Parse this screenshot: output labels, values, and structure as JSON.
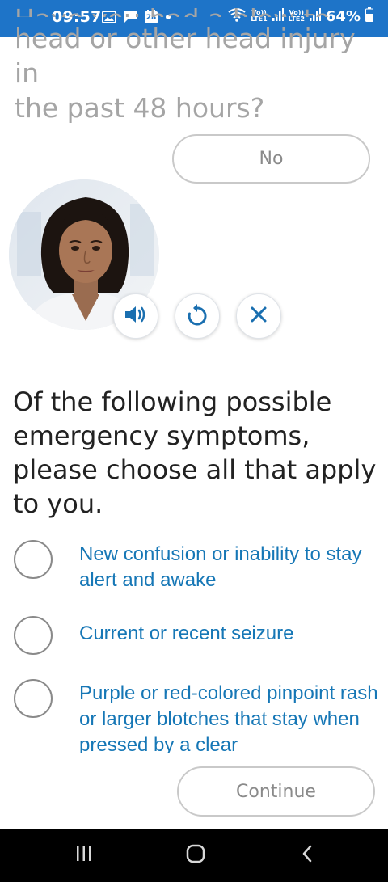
{
  "status_bar": {
    "time": "09:57",
    "calendar_day": "28",
    "battery_percent": "64%",
    "sim1_label_top": "Vo))",
    "sim1_label_bottom": "LTE1",
    "sim2_label_top": "Vo))",
    "sim2_label_bottom": "LTE2",
    "bar_color": "#1e74c8"
  },
  "previous": {
    "question_line_partial": "Have you had a blow to the",
    "question_line_2": "head or other head injury in",
    "question_line_3": "the past 48 hours?",
    "answer": "No"
  },
  "assistant": {
    "avatar": "female-doctor-avatar",
    "controls": [
      {
        "name": "audio",
        "icon": "speaker-icon"
      },
      {
        "name": "replay",
        "icon": "replay-icon"
      },
      {
        "name": "close",
        "icon": "close-icon"
      }
    ]
  },
  "question": {
    "text": "Of the following possible emergency symptoms, please choose all that apply to you."
  },
  "options": [
    {
      "label": "New confusion or inability to stay alert and awake",
      "selected": false
    },
    {
      "label": "Current or recent seizure",
      "selected": false
    },
    {
      "label": "Purple or red-colored pinpoint rash or larger blotches that stay when pressed by a clear",
      "selected": false
    }
  ],
  "continue_button": {
    "label": "Continue"
  },
  "nav_bar": {
    "recent": "recent-apps-icon",
    "home": "home-icon",
    "back": "back-icon"
  },
  "colors": {
    "accent": "#1677b6",
    "faded_text": "#a5a5a5",
    "button_border": "#c9c9c9"
  }
}
